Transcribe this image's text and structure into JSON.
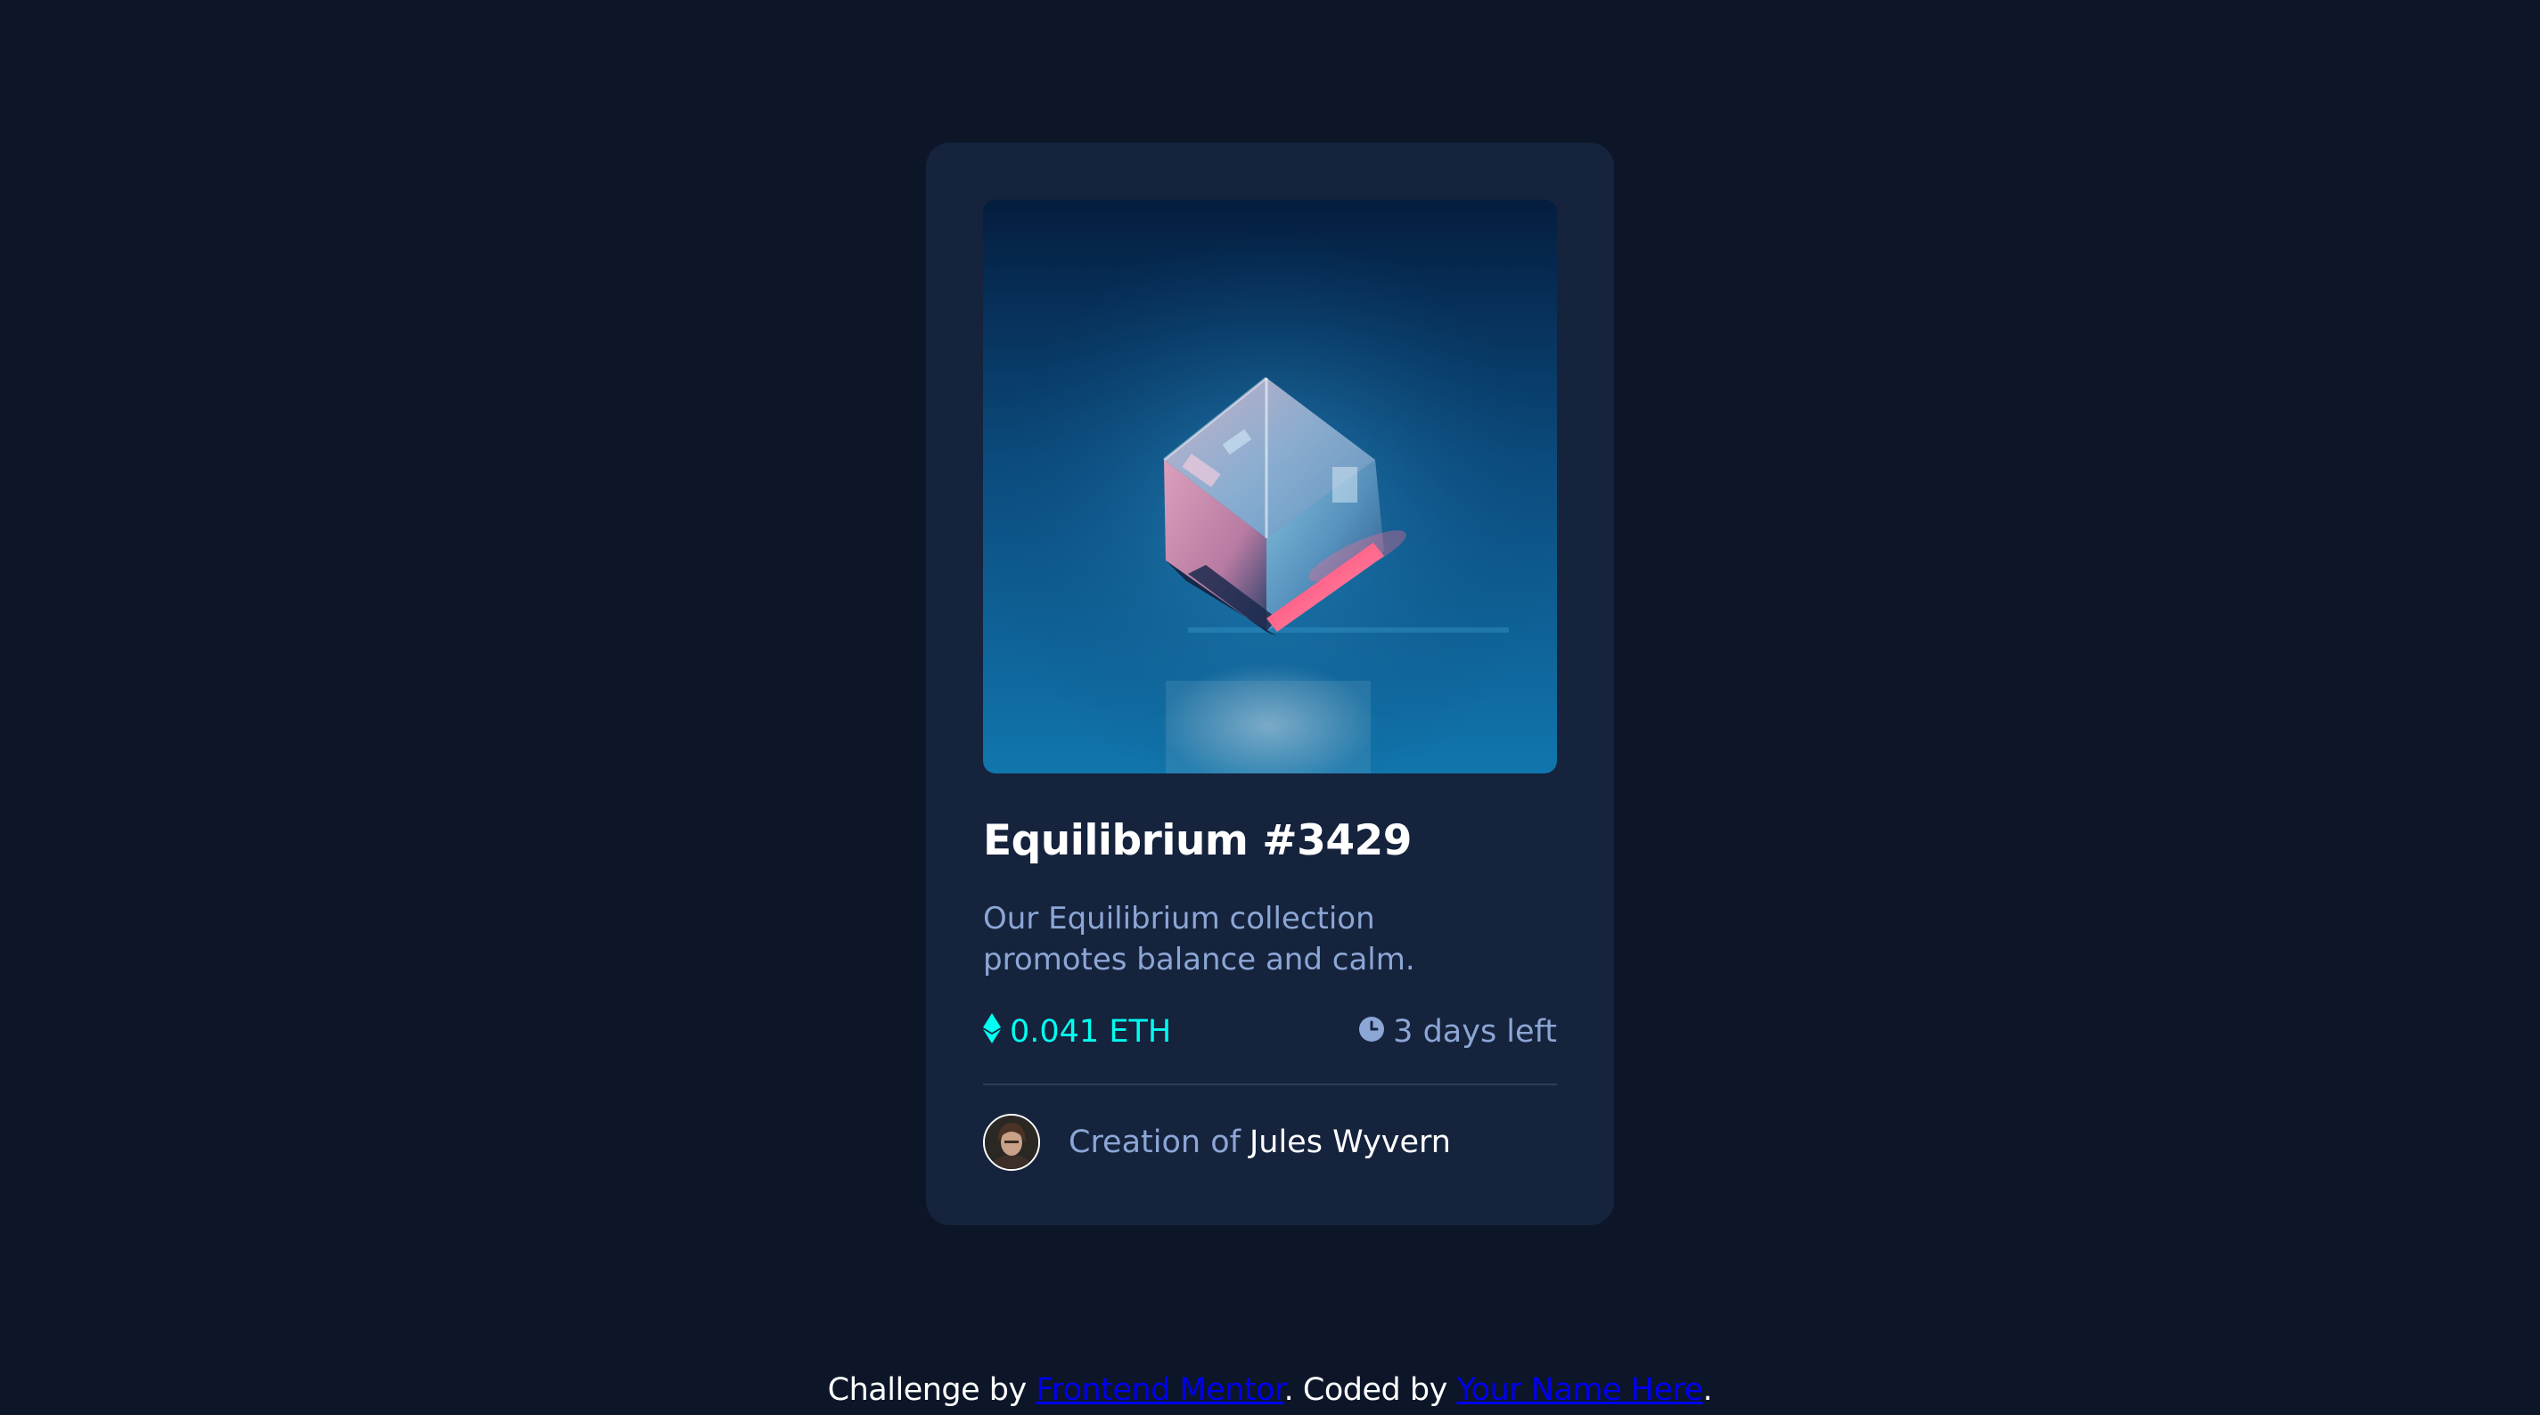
{
  "card": {
    "title": "Equilibrium #3429",
    "description": "Our Equilibrium collection promotes balance and calm.",
    "price": "0.041 ETH",
    "time_left": "3 days left",
    "creator_prefix": "Creation of",
    "creator_name": "Jules Wyvern"
  },
  "attribution": {
    "prefix": "Challenge by",
    "link1": "Frontend Mentor",
    "middle": ". Coded by",
    "link2": "Your Name Here",
    "suffix": "."
  },
  "icons": {
    "price": "ethereum-icon",
    "time": "clock-icon"
  },
  "colors": {
    "page_bg": "#0d1628",
    "card_bg": "#15233d",
    "accent_cyan": "#00fff0",
    "soft_blue": "#8ca6d5",
    "white": "#ffffff"
  }
}
